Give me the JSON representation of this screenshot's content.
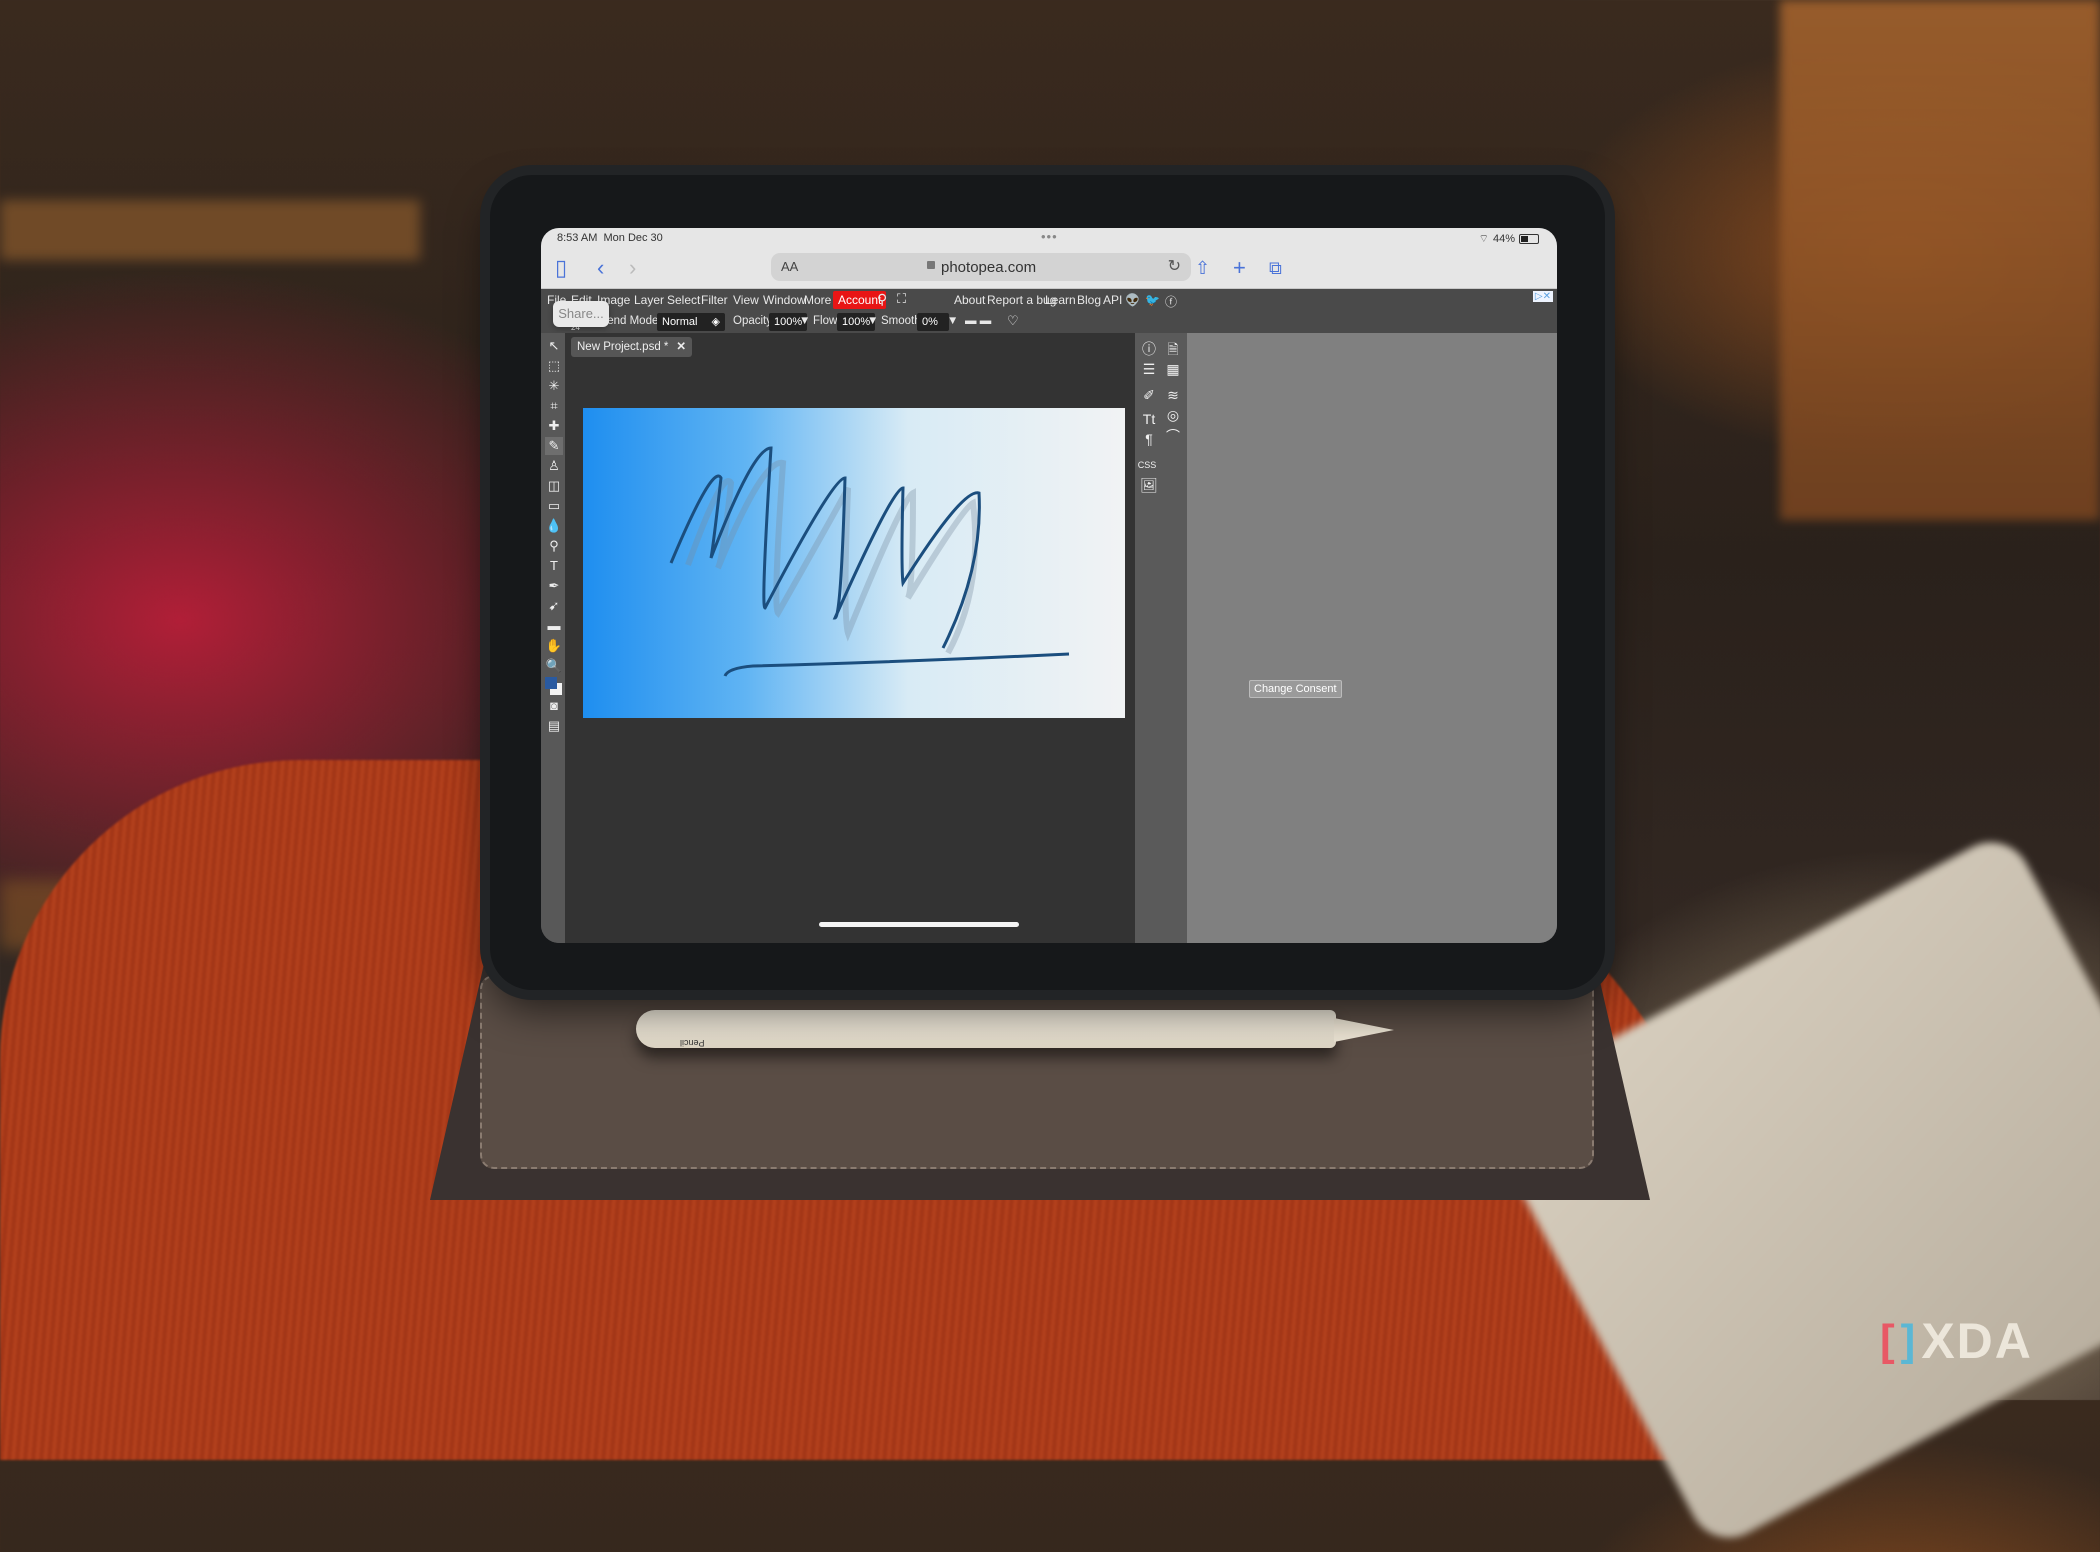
{
  "status_bar": {
    "time": "8:53 AM",
    "date": "Mon Dec 30",
    "battery": "44%",
    "dots": "•••"
  },
  "safari": {
    "text_size_label": "AA",
    "url": "photopea.com",
    "icons": [
      "sidebar-icon",
      "back-icon",
      "forward-icon",
      "lock-icon",
      "reload-icon",
      "share-icon",
      "new-tab-icon",
      "tabs-icon"
    ]
  },
  "share_popup": {
    "label": "Share..."
  },
  "menu": {
    "items": [
      "File",
      "Edit",
      "Image",
      "Layer",
      "Select",
      "Filter",
      "View",
      "Window",
      "More"
    ],
    "account": "Account",
    "right_links": [
      "About",
      "Report a bug",
      "Learn",
      "Blog",
      "API"
    ],
    "social_icons": [
      "reddit-icon",
      "twitter-icon",
      "facebook-icon"
    ],
    "ad_badge": "▷✕"
  },
  "options_bar": {
    "brush_size": "24",
    "blend_mode_label": "Blend Mode:",
    "blend_mode_value": "Normal",
    "opacity_label": "Opacity:",
    "opacity_value": "100%",
    "flow_label": "Flow:",
    "flow_value": "100%",
    "smooth_label": "Smooth:",
    "smooth_value": "0%"
  },
  "document": {
    "tab_title": "New Project.psd *",
    "close": "✕"
  },
  "tools": [
    {
      "name": "move-tool",
      "glyph": "↖"
    },
    {
      "name": "marquee-tool",
      "glyph": "⬚"
    },
    {
      "name": "magic-wand-tool",
      "glyph": "✳"
    },
    {
      "name": "crop-tool",
      "glyph": "⌗"
    },
    {
      "name": "healing-tool",
      "glyph": "✚"
    },
    {
      "name": "brush-tool",
      "glyph": "✎",
      "active": true
    },
    {
      "name": "stamp-tool",
      "glyph": "♙"
    },
    {
      "name": "eraser-tool",
      "glyph": "◫"
    },
    {
      "name": "gradient-tool",
      "glyph": "▭"
    },
    {
      "name": "blur-tool",
      "glyph": "💧"
    },
    {
      "name": "dodge-tool",
      "glyph": "⚲"
    },
    {
      "name": "type-tool",
      "glyph": "T"
    },
    {
      "name": "pen-tool",
      "glyph": "✒"
    },
    {
      "name": "path-select-tool",
      "glyph": "➹"
    },
    {
      "name": "shape-tool",
      "glyph": "▬"
    },
    {
      "name": "hand-tool",
      "glyph": "✋"
    },
    {
      "name": "zoom-tool",
      "glyph": "🔍"
    },
    {
      "name": "quick-mask-tool",
      "glyph": "◙"
    },
    {
      "name": "screen-mode-tool",
      "glyph": "▤"
    }
  ],
  "colors": {
    "foreground": "#2a5aa0",
    "background": "#f2f2f2",
    "accent": "#e81515"
  },
  "right_dock": [
    {
      "name": "info-icon",
      "glyph": "ⓘ"
    },
    {
      "name": "history-icon",
      "glyph": "🗎"
    },
    {
      "name": "adjustments-icon",
      "glyph": "☰"
    },
    {
      "name": "swatches-icon",
      "glyph": "▦"
    },
    {
      "name": "brush-panel-icon",
      "glyph": "✐"
    },
    {
      "name": "layers-icon",
      "glyph": "≋"
    },
    {
      "name": "character-icon",
      "glyph": "Tt"
    },
    {
      "name": "channels-icon",
      "glyph": "◎"
    },
    {
      "name": "paragraph-icon",
      "glyph": "¶"
    },
    {
      "name": "paths-icon",
      "glyph": "⌒"
    },
    {
      "name": "css-icon",
      "glyph": "CSS"
    },
    {
      "name": "image-icon",
      "glyph": "🖼"
    }
  ],
  "consent_button": "Change Consent",
  "pencil_label": "Pencil",
  "watermark": {
    "left": "[",
    "right": "]",
    "text": "XDA"
  }
}
